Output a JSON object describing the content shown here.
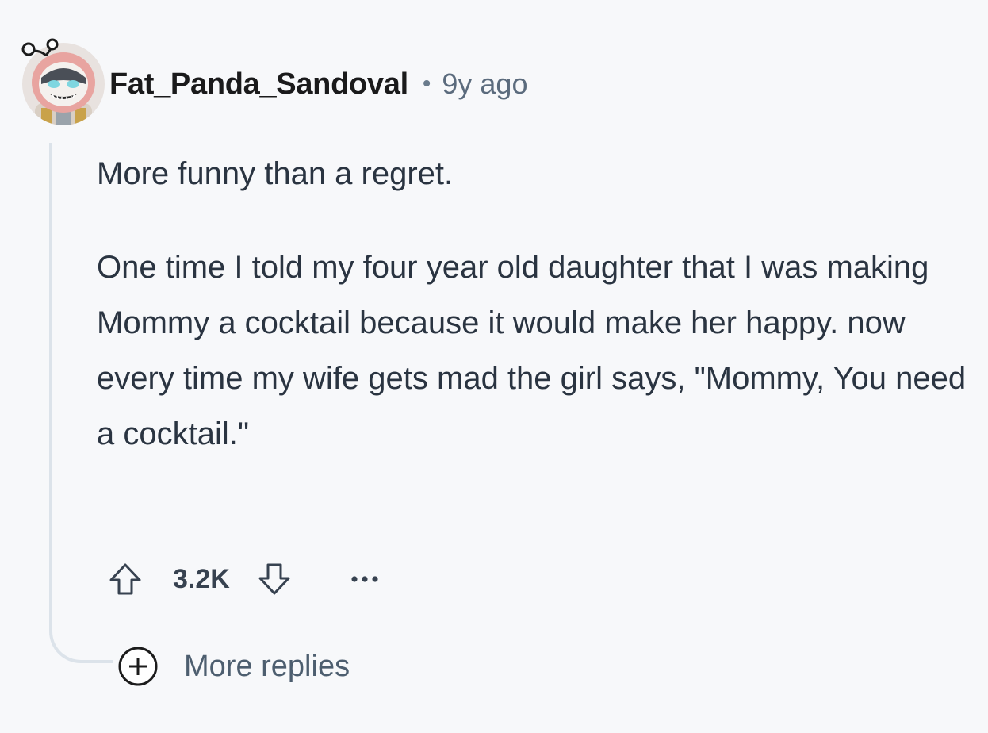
{
  "comment": {
    "username": "Fat_Panda_Sandoval",
    "separator": "•",
    "age": "9y ago",
    "paragraphs": [
      "More funny than a regret.",
      "One time I told my four year old daughter that I was making Mommy a cocktail because it would make her happy. now every time my wife gets mad the girl says, \"Mommy, You need a cocktail.\""
    ],
    "score": "3.2K",
    "more_replies_label": "More replies"
  },
  "icons": {
    "upvote": "arrow-up-icon",
    "downvote": "arrow-down-icon",
    "overflow": "ellipsis-icon",
    "expand": "plus-circle-icon"
  },
  "colors": {
    "background": "#f7f8fa",
    "text": "#2a3441",
    "meta": "#5b6b7d",
    "thread_line": "#dce3ea",
    "avatar_bg": "#e8e2df",
    "avatar_hood": "#e8a4a0"
  }
}
